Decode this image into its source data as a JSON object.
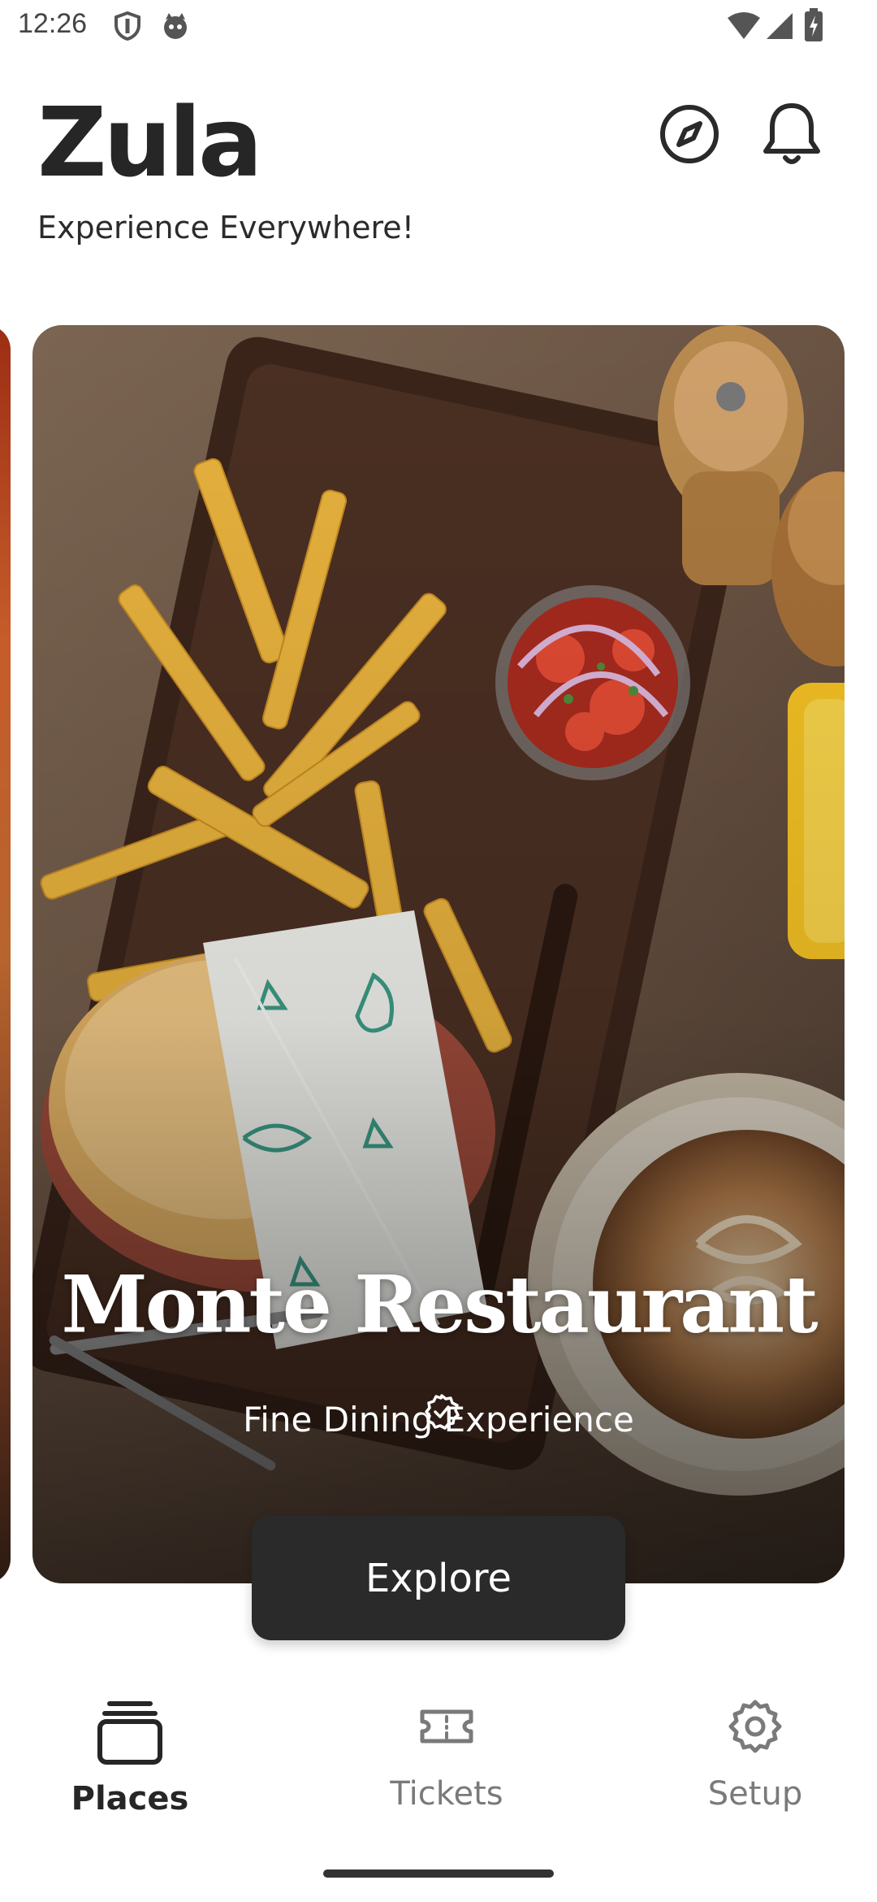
{
  "status_bar": {
    "time": "12:26",
    "left_icons": [
      "shield-icon",
      "cat-face-icon"
    ],
    "right_icons": [
      "wifi-icon",
      "signal-icon",
      "battery-charging-icon"
    ]
  },
  "header": {
    "brand": "Zula",
    "tagline": "Experience Everywhere!",
    "actions": [
      "compass-icon",
      "bell-icon"
    ]
  },
  "featured_card": {
    "title": "Monte Restaurant",
    "verified_icon": "verified-check-icon",
    "subtitle": "Fine Dining Experience",
    "cta_label": "Explore"
  },
  "bottom_nav": {
    "items": [
      {
        "label": "Places",
        "icon": "cards-stack-icon",
        "active": true
      },
      {
        "label": "Tickets",
        "icon": "ticket-icon",
        "active": false
      },
      {
        "label": "Setup",
        "icon": "gear-icon",
        "active": false
      }
    ]
  },
  "colors": {
    "text_primary": "#262626",
    "text_inactive": "#7a7a7a",
    "button_dark": "#2a2a2a",
    "background": "#ffffff"
  }
}
